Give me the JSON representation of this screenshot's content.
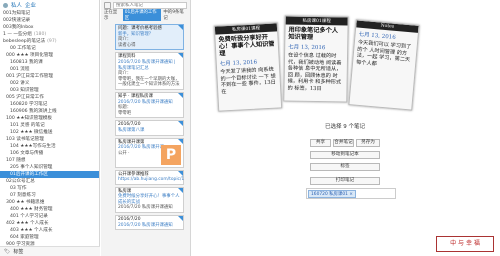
{
  "sidebar": {
    "header": [
      "私人",
      "企业"
    ],
    "tree": [
      {
        "label": "001为知笔记",
        "count": ""
      },
      {
        "label": "002快速记录",
        "count": ""
      },
      {
        "label": "003我的Inbox",
        "count": ""
      },
      {
        "label": "1 — 一些分组",
        "count": "(180)"
      },
      {
        "label": "bebesleep的笔记法",
        "count": "(97)"
      },
      {
        "label": "00 工作笔记",
        "count": ""
      },
      {
        "label": "000 ★★★ 项目化管理",
        "count": ""
      },
      {
        "label": "160813 我的课",
        "count": ""
      },
      {
        "label": "001 流程",
        "count": ""
      },
      {
        "label": "001 沪江日常工作管理",
        "count": ""
      },
      {
        "label": "002 讲义",
        "count": ""
      },
      {
        "label": "003 知识管理",
        "count": ""
      },
      {
        "label": "005 沪江日常工作",
        "count": ""
      },
      {
        "label": "160820 学习笔记",
        "count": ""
      },
      {
        "label": "160906 我的演讲上线",
        "count": ""
      },
      {
        "label": "100 ★★知识管理模板",
        "count": ""
      },
      {
        "label": "101 灵感 的笔记",
        "count": ""
      },
      {
        "label": "102 ★★★ 微信推送",
        "count": ""
      },
      {
        "label": "103 读书笔记管理",
        "count": ""
      },
      {
        "label": "104 ★★★写作与生活",
        "count": ""
      },
      {
        "label": "106 文章与传播",
        "count": ""
      },
      {
        "label": "107 随想",
        "count": ""
      },
      {
        "label": "205 事个人知识管理",
        "count": ""
      },
      {
        "label": "01后开课的工作区",
        "count": ""
      },
      {
        "label": "02公众号汇总",
        "count": ""
      },
      {
        "label": "03 写作",
        "count": ""
      },
      {
        "label": "07 刻意练习",
        "count": ""
      },
      {
        "label": "300 ★★ 书籍思维",
        "count": ""
      },
      {
        "label": "400 ★★★ 财务管理",
        "count": ""
      },
      {
        "label": "401 个人学习记录",
        "count": ""
      },
      {
        "label": "402 ★★★ 个人成长",
        "count": ""
      },
      {
        "label": "403 ★★★ 个人成长",
        "count": ""
      },
      {
        "label": "604 家庭管理",
        "count": ""
      },
      {
        "label": "900 学习资源",
        "count": ""
      }
    ],
    "selected_index": 23,
    "footer": "标签"
  },
  "notelist": {
    "search_placeholder": "搜索私人笔记",
    "crumb_prefix": "正在显示",
    "crumb_selected": "01后开课的工作区",
    "crumb_suffix": "中的9条笔记",
    "cards": [
      {
        "title": "问题：课考价格考验感",
        "lines": [
          "新手，知识管理？",
          "简介：",
          "读者心得"
        ],
        "date": ""
      },
      {
        "title": "课程资料",
        "lines": [
          "2016/7/20 私房课开课通知 | 私房课笔记汇总",
          "简介：",
          "零零吧，我在一个早期的大咖，",
          "一般化建立一个知识体系的方法"
        ],
        "date": "2016/7/20"
      },
      {
        "title": "知乎 · 课程私房课",
        "lines": [
          "2016/7/20 私房课开课通知",
          "标题：",
          "零零吧"
        ],
        "date": ""
      },
      {
        "title": "2016/7/20",
        "lines": [
          "私房课第八课"
        ],
        "date": ""
      },
      {
        "title": "私房课开课第",
        "lines": [
          "2016/7/20 私房课开课",
          "公开 ·"
        ],
        "date": ""
      },
      {
        "title": "公开课参课推荐",
        "lines": [
          "https://ab.hujiang.com/topic/16933743"
        ],
        "date": ""
      },
      {
        "title": "私房课",
        "lines": [
          "免费时候分享好开心！事事个人成长的实战",
          "2016/7/20 私房课开课通知"
        ],
        "date": ""
      },
      {
        "title": "2016/7/20",
        "lines": [
          "2016/7/20 私房课开课通知"
        ],
        "date": ""
      }
    ]
  },
  "main": {
    "papers": [
      {
        "header": "私房课01课程",
        "big": "免费听我分享好开心！事事个人知识管理",
        "date": "七月 13, 2016",
        "body": "今天发了讲我的 向系统的一个目标讨论 一下 想不到在一些 事件，13日在"
      },
      {
        "header": "私房课01课程",
        "big": "用印象笔记多个人 知识管理",
        "date": "七月 13, 2016",
        "body": "在设个信息 过载的时代，我们被动地 阅读着各种信 息中无所适从，回 顾，回顾休息的 时候，利用卡 和多种形式的 标签，13日"
      },
      {
        "header": "Notes",
        "big": "",
        "date": "七月 13, 2016",
        "body": "今天我们可以 学习到了的个 人时间管理 的方法，一起 学习，第二天 每个人都"
      }
    ],
    "selected_count": "已选择 9 个笔记",
    "buttons": {
      "share": "共享",
      "merge": "合并笔记",
      "save_as": "另存为",
      "move": "移动到笔记本",
      "tag": "标签",
      "print": "打印笔记"
    },
    "tag_chip": "160720 私房课01 ×",
    "logo_text": "中 与 幸 福"
  }
}
